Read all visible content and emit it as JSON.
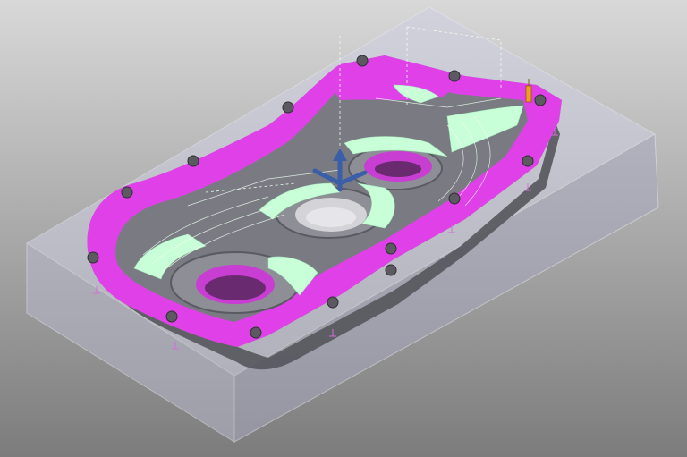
{
  "viewport": {
    "background_top": "#d8d8d8",
    "background_bottom": "#7c7c7c"
  },
  "scene": {
    "stock_color": "#c9c9dc",
    "part_color": "#8a8a90",
    "face_highlight_color": "#e040e8",
    "toolpath_color": "#c9ffd8",
    "triad_color": "#3a5ea8",
    "tool_marker_color": "#f0a020",
    "icons": [
      "view-triad-icon",
      "tool-position-icon"
    ]
  }
}
